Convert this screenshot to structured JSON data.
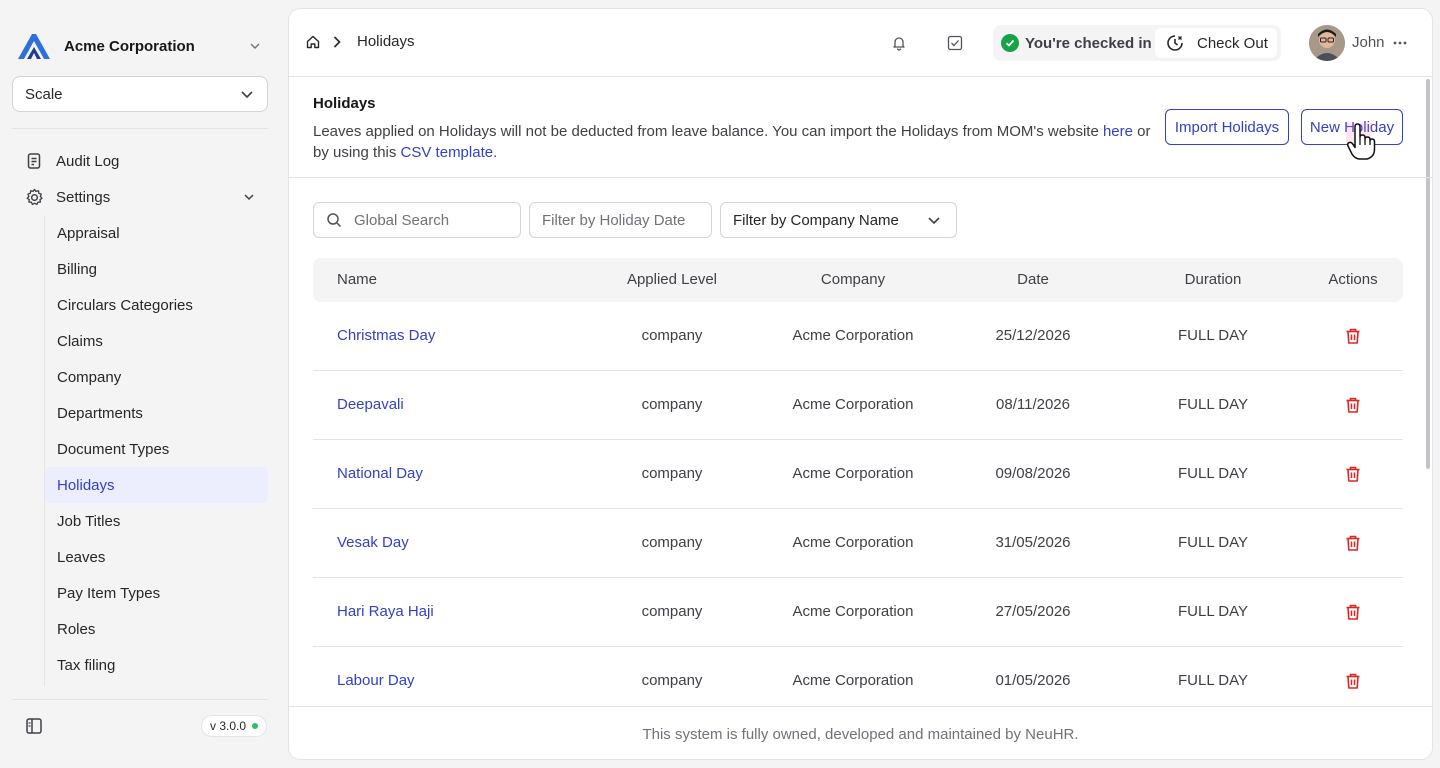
{
  "brand": {
    "name": "Acme Corporation"
  },
  "plan_select": {
    "value": "Scale"
  },
  "nav": {
    "audit_log": "Audit Log",
    "settings": "Settings",
    "sub_items": [
      {
        "label": "Appraisal"
      },
      {
        "label": "Billing"
      },
      {
        "label": "Circulars Categories"
      },
      {
        "label": "Claims"
      },
      {
        "label": "Company"
      },
      {
        "label": "Departments"
      },
      {
        "label": "Document Types"
      },
      {
        "label": "Holidays",
        "active": true
      },
      {
        "label": "Job Titles"
      },
      {
        "label": "Leaves"
      },
      {
        "label": "Pay Item Types"
      },
      {
        "label": "Roles"
      },
      {
        "label": "Tax filing"
      }
    ]
  },
  "version": "v 3.0.0",
  "topbar": {
    "breadcrumb": "Holidays",
    "checkin_status": "You're checked in",
    "checkout_label": "Check Out",
    "user_name": "John"
  },
  "intro": {
    "title": "Holidays",
    "text_before": "Leaves applied on Holidays will not be deducted from leave balance. You can import the Holidays from MOM's website ",
    "link_here": "here",
    "text_middle": " or by using this ",
    "link_csv": "CSV template.",
    "import_button": "Import Holidays",
    "new_button": "New Holiday"
  },
  "filters": {
    "search_placeholder": "Global Search",
    "date_placeholder": "Filter by Holiday Date",
    "company_filter": "Filter by Company Name"
  },
  "table": {
    "headers": {
      "name": "Name",
      "level": "Applied Level",
      "company": "Company",
      "date": "Date",
      "duration": "Duration",
      "actions": "Actions"
    },
    "rows": [
      {
        "name": "Christmas Day",
        "level": "company",
        "company": "Acme Corporation",
        "date": "25/12/2026",
        "duration": "FULL DAY"
      },
      {
        "name": "Deepavali",
        "level": "company",
        "company": "Acme Corporation",
        "date": "08/11/2026",
        "duration": "FULL DAY"
      },
      {
        "name": "National Day",
        "level": "company",
        "company": "Acme Corporation",
        "date": "09/08/2026",
        "duration": "FULL DAY"
      },
      {
        "name": "Vesak Day",
        "level": "company",
        "company": "Acme Corporation",
        "date": "31/05/2026",
        "duration": "FULL DAY"
      },
      {
        "name": "Hari Raya Haji",
        "level": "company",
        "company": "Acme Corporation",
        "date": "27/05/2026",
        "duration": "FULL DAY"
      },
      {
        "name": "Labour Day",
        "level": "company",
        "company": "Acme Corporation",
        "date": "01/05/2026",
        "duration": "FULL DAY"
      }
    ]
  },
  "footer": "This system is fully owned, developed and maintained by NeuHR.",
  "colors": {
    "accent": "#3341c7",
    "delete": "#dc2626",
    "success": "#16a34a"
  }
}
